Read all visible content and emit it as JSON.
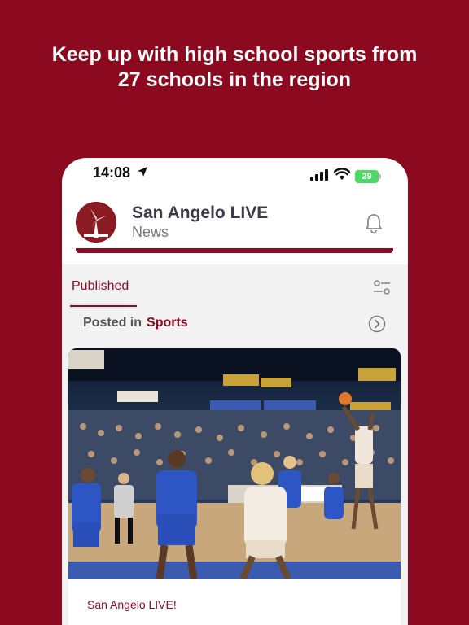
{
  "headline": {
    "line1": "Keep up with high school sports from",
    "line2": "27 schools in the region"
  },
  "status_bar": {
    "time": "14:08",
    "battery": "29",
    "icons": [
      "location-arrow-icon",
      "signal-icon",
      "wifi-icon",
      "battery-icon"
    ]
  },
  "app_header": {
    "title": "San Angelo LIVE",
    "subtitle": "News",
    "icons": [
      "logo-icon",
      "bell-icon"
    ]
  },
  "tabs": {
    "published": "Published"
  },
  "filter": {
    "posted_in_label": "Posted in",
    "category": "Sports",
    "icons": [
      "filter-sliders-icon",
      "chevron-right-circle-icon"
    ]
  },
  "card": {
    "source": "San Angelo LIVE!",
    "image": "basketball-game-photo"
  },
  "colors": {
    "brand": "#8b0a1f",
    "battery_green": "#4cd964",
    "text_dark": "#3a3a48"
  }
}
